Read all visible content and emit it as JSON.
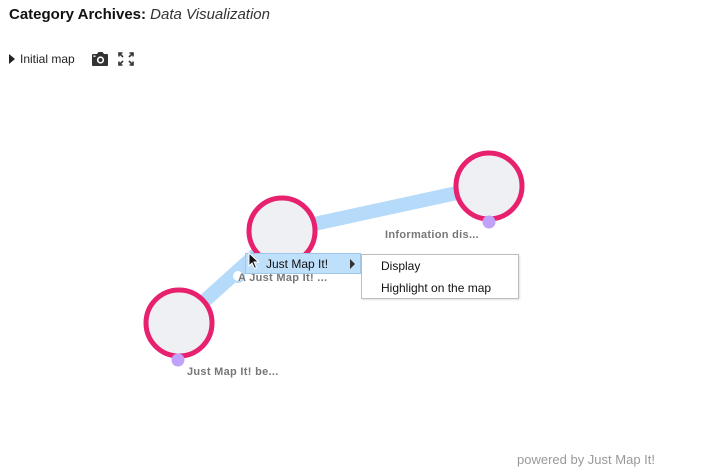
{
  "header": {
    "title_prefix": "Category Archives:",
    "category": "Data Visualization"
  },
  "toolbar": {
    "map_toggle_label": "Initial map",
    "camera_icon": "camera-icon",
    "fullscreen_icon": "fullscreen-icon"
  },
  "map": {
    "colors": {
      "node_ring": "#e8216f",
      "node_fill": "#eef0f4",
      "edge": "#b5dafa",
      "handle": "#c0a3f8"
    },
    "nodes": [
      {
        "label": "Information dis..."
      },
      {
        "label": "A Just Map It! ..."
      },
      {
        "label": "Just Map It! be..."
      }
    ]
  },
  "context_menu": {
    "item_label": "Just Map It!",
    "submenu": [
      "Display",
      "Highlight on the map"
    ]
  },
  "footer": {
    "powered_by": "powered by Just Map It!"
  }
}
